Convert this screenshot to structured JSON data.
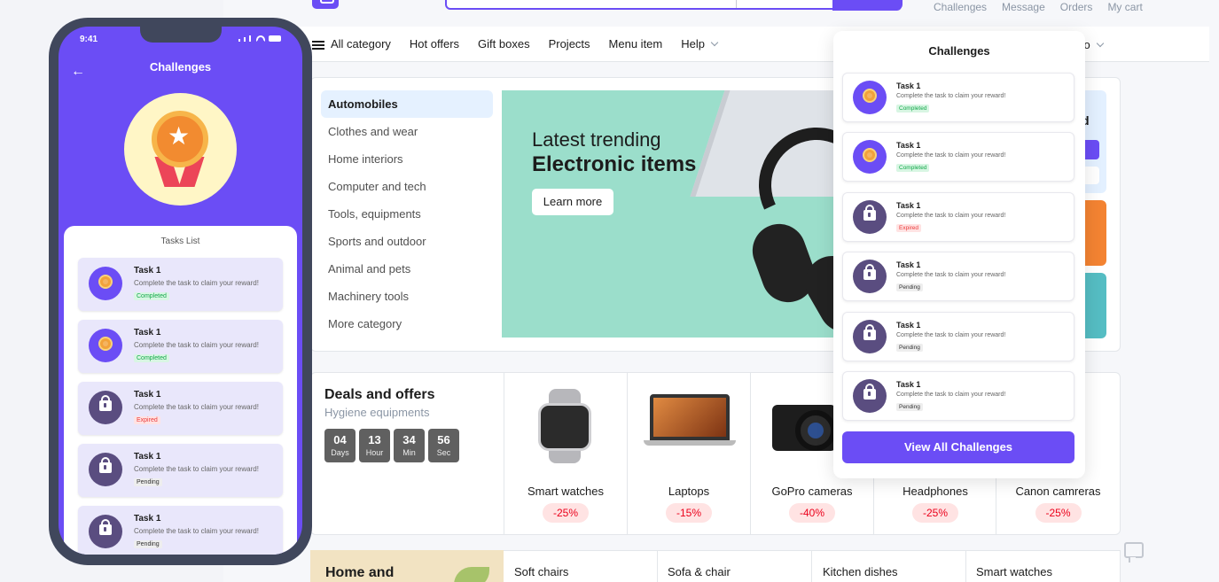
{
  "topbar": {
    "links": [
      "Challenges",
      "Message",
      "Orders",
      "My cart"
    ]
  },
  "nav": {
    "items": [
      "All category",
      "Hot offers",
      "Gift boxes",
      "Projects",
      "Menu item",
      "Help"
    ],
    "ship_to": "p to"
  },
  "categories": [
    "Automobiles",
    "Clothes and wear",
    "Home interiors",
    "Computer and tech",
    "Tools, equipments",
    "Sports and outdoor",
    "Animal and pets",
    "Machinery tools",
    "More category"
  ],
  "banner": {
    "line1": "Latest trending",
    "line2": "Electronic items",
    "button": "Learn more"
  },
  "right_card": {
    "letter": "d"
  },
  "deals": {
    "title": "Deals and offers",
    "subtitle": "Hygiene equipments",
    "timer": [
      {
        "value": "04",
        "label": "Days"
      },
      {
        "value": "13",
        "label": "Hour"
      },
      {
        "value": "34",
        "label": "Min"
      },
      {
        "value": "56",
        "label": "Sec"
      }
    ],
    "products": [
      {
        "name": "Smart watches",
        "discount": "-25%"
      },
      {
        "name": "Laptops",
        "discount": "-15%"
      },
      {
        "name": "GoPro cameras",
        "discount": "-40%"
      },
      {
        "name": "Headphones",
        "discount": "-25%"
      },
      {
        "name": "Canon camreras",
        "discount": "-25%"
      }
    ]
  },
  "bottom": {
    "home_title": "Home and",
    "items": [
      "Soft chairs",
      "Sofa & chair",
      "Kitchen dishes",
      "Smart watches"
    ]
  },
  "dropdown": {
    "title": "Challenges",
    "tasks": [
      {
        "name": "Task 1",
        "desc": "Complete the task to claim your reward!",
        "status": "Completed"
      },
      {
        "name": "Task 1",
        "desc": "Complete the task to claim your reward!",
        "status": "Completed"
      },
      {
        "name": "Task 1",
        "desc": "Complete the task to claim your reward!",
        "status": "Expired"
      },
      {
        "name": "Task 1",
        "desc": "Complete the task to claim your reward!",
        "status": "Pending"
      },
      {
        "name": "Task 1",
        "desc": "Complete the task to claim your reward!",
        "status": "Pending"
      },
      {
        "name": "Task 1",
        "desc": "Complete the task to claim your reward!",
        "status": "Pending"
      }
    ],
    "button": "View All Challenges"
  },
  "phone": {
    "time": "9:41",
    "title": "Challenges",
    "list_title": "Tasks List",
    "tasks": [
      {
        "name": "Task 1",
        "desc": "Complete the task to claim your reward!",
        "status": "Completed"
      },
      {
        "name": "Task 1",
        "desc": "Complete the task to claim your reward!",
        "status": "Completed"
      },
      {
        "name": "Task 1",
        "desc": "Complete the task to claim your reward!",
        "status": "Expired"
      },
      {
        "name": "Task 1",
        "desc": "Complete the task to claim your reward!",
        "status": "Pending"
      },
      {
        "name": "Task 1",
        "desc": "Complete the task to claim your reward!",
        "status": "Pending"
      }
    ]
  },
  "colors": {
    "accent": "#6b4df5",
    "completed": "#13a84a",
    "expired": "#eb3b3b"
  }
}
